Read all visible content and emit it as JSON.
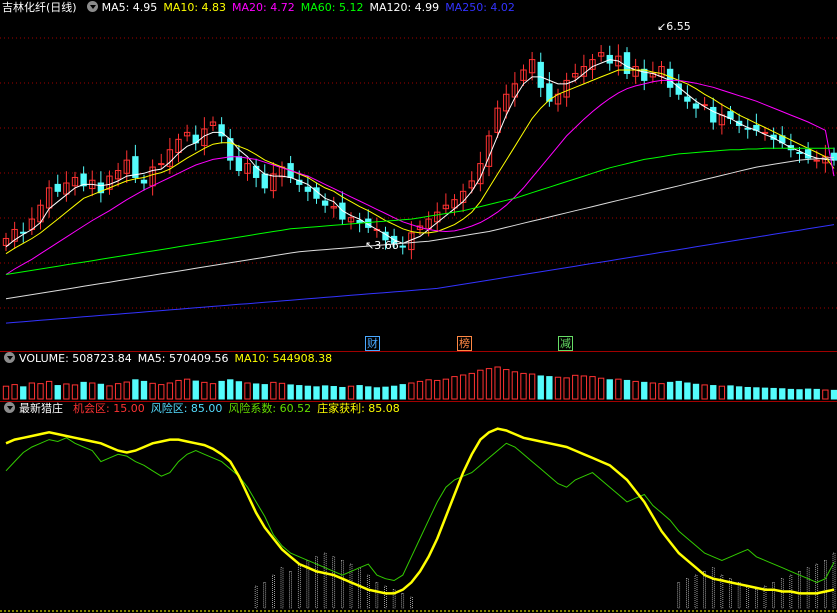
{
  "header": {
    "title": "吉林化纤(日线)",
    "indicators": [
      {
        "label": "MA5: 4.95",
        "color": "#ffffff"
      },
      {
        "label": "MA10: 4.83",
        "color": "#ffff00"
      },
      {
        "label": "MA20: 4.72",
        "color": "#ff00ff"
      },
      {
        "label": "MA60: 5.12",
        "color": "#00ff00"
      },
      {
        "label": "MA120: 4.99",
        "color": "#ffffff"
      },
      {
        "label": "MA250: 4.02",
        "color": "#3333ff"
      }
    ]
  },
  "price_panel": {
    "high_label": "6.55",
    "low_label": "3.66",
    "markers": [
      {
        "text": "财",
        "color": "#4aa8ff"
      },
      {
        "text": "榜",
        "color": "#ff8844"
      },
      {
        "text": "减",
        "color": "#66dd66"
      }
    ]
  },
  "volume_panel": {
    "indicators": [
      {
        "label": "VOLUME: 508723.84",
        "color": "#ffffff"
      },
      {
        "label": "MA5: 570409.56",
        "color": "#ffffff"
      },
      {
        "label": "MA10: 544908.38",
        "color": "#ffff00"
      }
    ]
  },
  "indicator_panel": {
    "name": "最新猎庄",
    "indicators": [
      {
        "label": "机会区: 15.00",
        "color": "#ff3333"
      },
      {
        "label": "风险区: 85.00",
        "color": "#55ddff"
      },
      {
        "label": "风险系数: 60.52",
        "color": "#66dd00"
      },
      {
        "label": "庄家获利: 85.08",
        "color": "#ffff00"
      }
    ]
  },
  "colors": {
    "up": "#ff3232",
    "down": "#54fcfc",
    "grid": "#a00000",
    "background": "#000000"
  },
  "chart_data": {
    "type": "line",
    "y_range_price": [
      2.5,
      7.0
    ],
    "candles_close": [
      3.82,
      3.95,
      3.9,
      4.1,
      4.3,
      4.55,
      4.5,
      4.62,
      4.7,
      4.58,
      4.66,
      4.48,
      4.72,
      4.8,
      4.95,
      4.7,
      4.62,
      4.85,
      4.9,
      5.1,
      5.25,
      5.35,
      5.2,
      5.4,
      5.5,
      5.3,
      4.95,
      4.8,
      4.9,
      4.7,
      4.55,
      4.75,
      4.85,
      4.7,
      4.6,
      4.5,
      4.4,
      4.3,
      4.28,
      4.1,
      4.12,
      4.05,
      3.98,
      3.95,
      3.8,
      3.75,
      3.7,
      3.9,
      4.0,
      4.1,
      4.2,
      4.3,
      4.38,
      4.5,
      4.65,
      4.9,
      5.3,
      5.7,
      5.9,
      6.05,
      6.25,
      6.4,
      6.0,
      5.8,
      5.9,
      6.1,
      6.2,
      6.3,
      6.4,
      6.5,
      6.35,
      6.45,
      6.2,
      6.3,
      6.1,
      6.2,
      6.3,
      6.0,
      5.9,
      5.8,
      5.7,
      5.75,
      5.5,
      5.6,
      5.55,
      5.45,
      5.4,
      5.38,
      5.35,
      5.25,
      5.2,
      5.1,
      5.05,
      4.98,
      4.95,
      5.0,
      4.95
    ],
    "ma5": [
      3.7,
      3.8,
      3.88,
      3.95,
      4.05,
      4.25,
      4.35,
      4.45,
      4.55,
      4.6,
      4.6,
      4.58,
      4.6,
      4.65,
      4.72,
      4.74,
      4.76,
      4.8,
      4.82,
      4.92,
      5.05,
      5.15,
      5.2,
      5.3,
      5.35,
      5.35,
      5.25,
      5.1,
      5.0,
      4.85,
      4.75,
      4.72,
      4.72,
      4.7,
      4.65,
      4.6,
      4.5,
      4.4,
      4.35,
      4.22,
      4.15,
      4.1,
      4.02,
      3.95,
      3.88,
      3.8,
      3.75,
      3.8,
      3.85,
      3.95,
      4.05,
      4.15,
      4.25,
      4.35,
      4.5,
      4.7,
      5.0,
      5.3,
      5.6,
      5.85,
      6.05,
      6.15,
      6.15,
      6.1,
      6.05,
      6.05,
      6.1,
      6.2,
      6.3,
      6.35,
      6.4,
      6.38,
      6.3,
      6.25,
      6.22,
      6.2,
      6.15,
      6.1,
      6.0,
      5.9,
      5.8,
      5.72,
      5.65,
      5.6,
      5.55,
      5.48,
      5.42,
      5.38,
      5.32,
      5.27,
      5.2,
      5.13,
      5.08,
      5.02,
      4.98,
      4.96,
      4.95
    ],
    "ma10": [
      3.6,
      3.68,
      3.75,
      3.82,
      3.9,
      4.0,
      4.1,
      4.2,
      4.3,
      4.4,
      4.45,
      4.5,
      4.55,
      4.6,
      4.65,
      4.68,
      4.7,
      4.74,
      4.77,
      4.82,
      4.9,
      4.98,
      5.05,
      5.12,
      5.18,
      5.2,
      5.2,
      5.15,
      5.1,
      5.03,
      4.95,
      4.9,
      4.85,
      4.8,
      4.75,
      4.7,
      4.62,
      4.55,
      4.5,
      4.42,
      4.35,
      4.28,
      4.22,
      4.15,
      4.08,
      4.02,
      3.96,
      3.92,
      3.9,
      3.9,
      3.92,
      3.97,
      4.02,
      4.1,
      4.2,
      4.35,
      4.55,
      4.75,
      4.95,
      5.15,
      5.35,
      5.55,
      5.7,
      5.82,
      5.9,
      5.95,
      6.0,
      6.05,
      6.1,
      6.15,
      6.2,
      6.25,
      6.25,
      6.25,
      6.25,
      6.22,
      6.2,
      6.15,
      6.1,
      6.05,
      5.98,
      5.9,
      5.83,
      5.75,
      5.68,
      5.6,
      5.54,
      5.48,
      5.42,
      5.36,
      5.3,
      5.24,
      5.18,
      5.12,
      5.06,
      5.0,
      4.83
    ],
    "ma20": [
      3.3,
      3.38,
      3.45,
      3.52,
      3.6,
      3.68,
      3.76,
      3.84,
      3.92,
      4.0,
      4.08,
      4.15,
      4.22,
      4.3,
      4.38,
      4.45,
      4.52,
      4.58,
      4.64,
      4.7,
      4.76,
      4.82,
      4.88,
      4.92,
      4.96,
      4.98,
      5.0,
      5.0,
      4.98,
      4.96,
      4.92,
      4.88,
      4.84,
      4.8,
      4.76,
      4.72,
      4.66,
      4.6,
      4.54,
      4.48,
      4.42,
      4.36,
      4.3,
      4.24,
      4.18,
      4.12,
      4.06,
      4.02,
      3.98,
      3.95,
      3.93,
      3.92,
      3.93,
      3.96,
      4.0,
      4.05,
      4.12,
      4.2,
      4.3,
      4.42,
      4.55,
      4.7,
      4.85,
      5.0,
      5.15,
      5.3,
      5.42,
      5.54,
      5.65,
      5.75,
      5.84,
      5.92,
      5.98,
      6.02,
      6.05,
      6.08,
      6.1,
      6.1,
      6.1,
      6.08,
      6.06,
      6.03,
      6.0,
      5.96,
      5.92,
      5.88,
      5.84,
      5.8,
      5.75,
      5.7,
      5.65,
      5.6,
      5.55,
      5.5,
      5.44,
      5.38,
      4.72
    ],
    "ma60": [
      3.3,
      3.32,
      3.34,
      3.36,
      3.38,
      3.4,
      3.42,
      3.44,
      3.46,
      3.48,
      3.5,
      3.52,
      3.54,
      3.56,
      3.58,
      3.6,
      3.62,
      3.64,
      3.66,
      3.68,
      3.7,
      3.72,
      3.74,
      3.76,
      3.78,
      3.8,
      3.82,
      3.84,
      3.86,
      3.88,
      3.9,
      3.92,
      3.94,
      3.96,
      3.97,
      3.98,
      3.99,
      4.0,
      4.01,
      4.02,
      4.03,
      4.04,
      4.05,
      4.06,
      4.07,
      4.08,
      4.09,
      4.1,
      4.12,
      4.14,
      4.16,
      4.18,
      4.2,
      4.22,
      4.25,
      4.28,
      4.31,
      4.34,
      4.37,
      4.4,
      4.44,
      4.48,
      4.52,
      4.56,
      4.6,
      4.64,
      4.68,
      4.72,
      4.76,
      4.8,
      4.84,
      4.87,
      4.9,
      4.93,
      4.96,
      4.98,
      5.0,
      5.02,
      5.04,
      5.05,
      5.06,
      5.07,
      5.08,
      5.09,
      5.1,
      5.1,
      5.11,
      5.11,
      5.12,
      5.12,
      5.12,
      5.12,
      5.12,
      5.12,
      5.12,
      5.12,
      5.12
    ],
    "ma120": [
      2.95,
      2.97,
      2.99,
      3.01,
      3.03,
      3.05,
      3.07,
      3.09,
      3.11,
      3.13,
      3.15,
      3.17,
      3.19,
      3.21,
      3.23,
      3.25,
      3.27,
      3.29,
      3.31,
      3.33,
      3.35,
      3.37,
      3.39,
      3.41,
      3.43,
      3.45,
      3.47,
      3.49,
      3.51,
      3.53,
      3.55,
      3.57,
      3.59,
      3.61,
      3.63,
      3.64,
      3.65,
      3.66,
      3.67,
      3.68,
      3.69,
      3.7,
      3.71,
      3.72,
      3.73,
      3.74,
      3.75,
      3.76,
      3.77,
      3.78,
      3.8,
      3.82,
      3.84,
      3.86,
      3.88,
      3.9,
      3.92,
      3.95,
      3.98,
      4.01,
      4.04,
      4.07,
      4.1,
      4.13,
      4.16,
      4.19,
      4.22,
      4.25,
      4.28,
      4.31,
      4.34,
      4.37,
      4.4,
      4.43,
      4.46,
      4.49,
      4.52,
      4.55,
      4.58,
      4.61,
      4.64,
      4.67,
      4.7,
      4.73,
      4.76,
      4.79,
      4.82,
      4.85,
      4.87,
      4.89,
      4.91,
      4.93,
      4.95,
      4.96,
      4.97,
      4.98,
      4.99
    ],
    "ma250": [
      2.6,
      2.61,
      2.62,
      2.63,
      2.64,
      2.65,
      2.66,
      2.67,
      2.68,
      2.69,
      2.7,
      2.71,
      2.72,
      2.73,
      2.74,
      2.75,
      2.76,
      2.77,
      2.78,
      2.79,
      2.8,
      2.81,
      2.82,
      2.83,
      2.84,
      2.85,
      2.86,
      2.87,
      2.88,
      2.89,
      2.9,
      2.91,
      2.92,
      2.93,
      2.94,
      2.95,
      2.96,
      2.97,
      2.98,
      2.99,
      3.0,
      3.01,
      3.02,
      3.03,
      3.04,
      3.05,
      3.06,
      3.07,
      3.08,
      3.09,
      3.1,
      3.12,
      3.14,
      3.16,
      3.18,
      3.2,
      3.22,
      3.24,
      3.26,
      3.28,
      3.3,
      3.32,
      3.34,
      3.36,
      3.38,
      3.4,
      3.42,
      3.44,
      3.46,
      3.48,
      3.5,
      3.52,
      3.54,
      3.56,
      3.58,
      3.6,
      3.62,
      3.64,
      3.66,
      3.68,
      3.7,
      3.72,
      3.74,
      3.76,
      3.78,
      3.8,
      3.82,
      3.84,
      3.86,
      3.88,
      3.9,
      3.92,
      3.94,
      3.96,
      3.98,
      4.0,
      4.02
    ],
    "volume": [
      40,
      45,
      38,
      50,
      48,
      55,
      42,
      47,
      44,
      52,
      50,
      46,
      41,
      48,
      53,
      60,
      55,
      49,
      45,
      50,
      58,
      62,
      56,
      52,
      48,
      55,
      60,
      54,
      50,
      47,
      45,
      52,
      49,
      44,
      42,
      40,
      38,
      41,
      39,
      36,
      40,
      42,
      38,
      35,
      37,
      40,
      45,
      50,
      55,
      60,
      58,
      62,
      70,
      75,
      80,
      90,
      95,
      100,
      92,
      85,
      80,
      78,
      72,
      70,
      68,
      66,
      74,
      72,
      70,
      65,
      60,
      62,
      58,
      55,
      52,
      50,
      48,
      52,
      55,
      50,
      46,
      44,
      42,
      40,
      41,
      38,
      36,
      35,
      34,
      33,
      32,
      30,
      29,
      31,
      30,
      28,
      27
    ],
    "indicator_yellow": [
      90,
      92,
      93,
      94,
      95,
      96,
      95,
      94,
      93,
      92,
      91,
      90,
      88,
      86,
      85,
      86,
      88,
      90,
      91,
      92,
      92,
      91,
      90,
      89,
      87,
      84,
      80,
      72,
      62,
      52,
      44,
      38,
      32,
      28,
      24,
      22,
      20,
      19,
      18,
      16,
      14,
      12,
      10,
      9,
      8,
      8,
      10,
      14,
      20,
      28,
      38,
      50,
      62,
      74,
      84,
      92,
      96,
      98,
      97,
      95,
      93,
      92,
      91,
      90,
      89,
      88,
      86,
      84,
      82,
      80,
      78,
      74,
      70,
      64,
      58,
      50,
      42,
      36,
      30,
      26,
      22,
      18,
      16,
      15,
      14,
      13,
      12,
      11,
      10,
      10,
      9,
      9,
      8,
      8,
      8,
      9,
      10
    ],
    "indicator_green": [
      75,
      80,
      85,
      88,
      90,
      92,
      91,
      93,
      90,
      88,
      86,
      80,
      82,
      84,
      83,
      80,
      78,
      75,
      72,
      74,
      80,
      84,
      86,
      84,
      82,
      80,
      76,
      72,
      66,
      58,
      50,
      40,
      34,
      30,
      28,
      26,
      24,
      22,
      20,
      18,
      20,
      22,
      24,
      18,
      16,
      15,
      18,
      28,
      38,
      48,
      58,
      66,
      70,
      72,
      74,
      78,
      82,
      86,
      90,
      88,
      84,
      80,
      76,
      72,
      68,
      66,
      70,
      72,
      74,
      70,
      66,
      62,
      58,
      60,
      62,
      56,
      52,
      48,
      42,
      38,
      34,
      30,
      28,
      26,
      28,
      30,
      32,
      28,
      26,
      24,
      22,
      20,
      18,
      16,
      14,
      16,
      25
    ],
    "bars_white": [
      0,
      0,
      0,
      0,
      0,
      0,
      0,
      0,
      0,
      0,
      0,
      0,
      0,
      0,
      0,
      0,
      0,
      0,
      0,
      0,
      0,
      0,
      0,
      0,
      0,
      0,
      0,
      0,
      0,
      12,
      14,
      18,
      22,
      20,
      24,
      26,
      28,
      30,
      28,
      26,
      24,
      22,
      18,
      14,
      12,
      10,
      8,
      6,
      0,
      0,
      0,
      0,
      0,
      0,
      0,
      0,
      0,
      0,
      0,
      0,
      0,
      0,
      0,
      0,
      0,
      0,
      0,
      0,
      0,
      0,
      0,
      0,
      0,
      0,
      0,
      0,
      0,
      0,
      14,
      16,
      18,
      20,
      22,
      18,
      16,
      14,
      12,
      10,
      12,
      14,
      16,
      18,
      20,
      22,
      24,
      26,
      30
    ]
  }
}
